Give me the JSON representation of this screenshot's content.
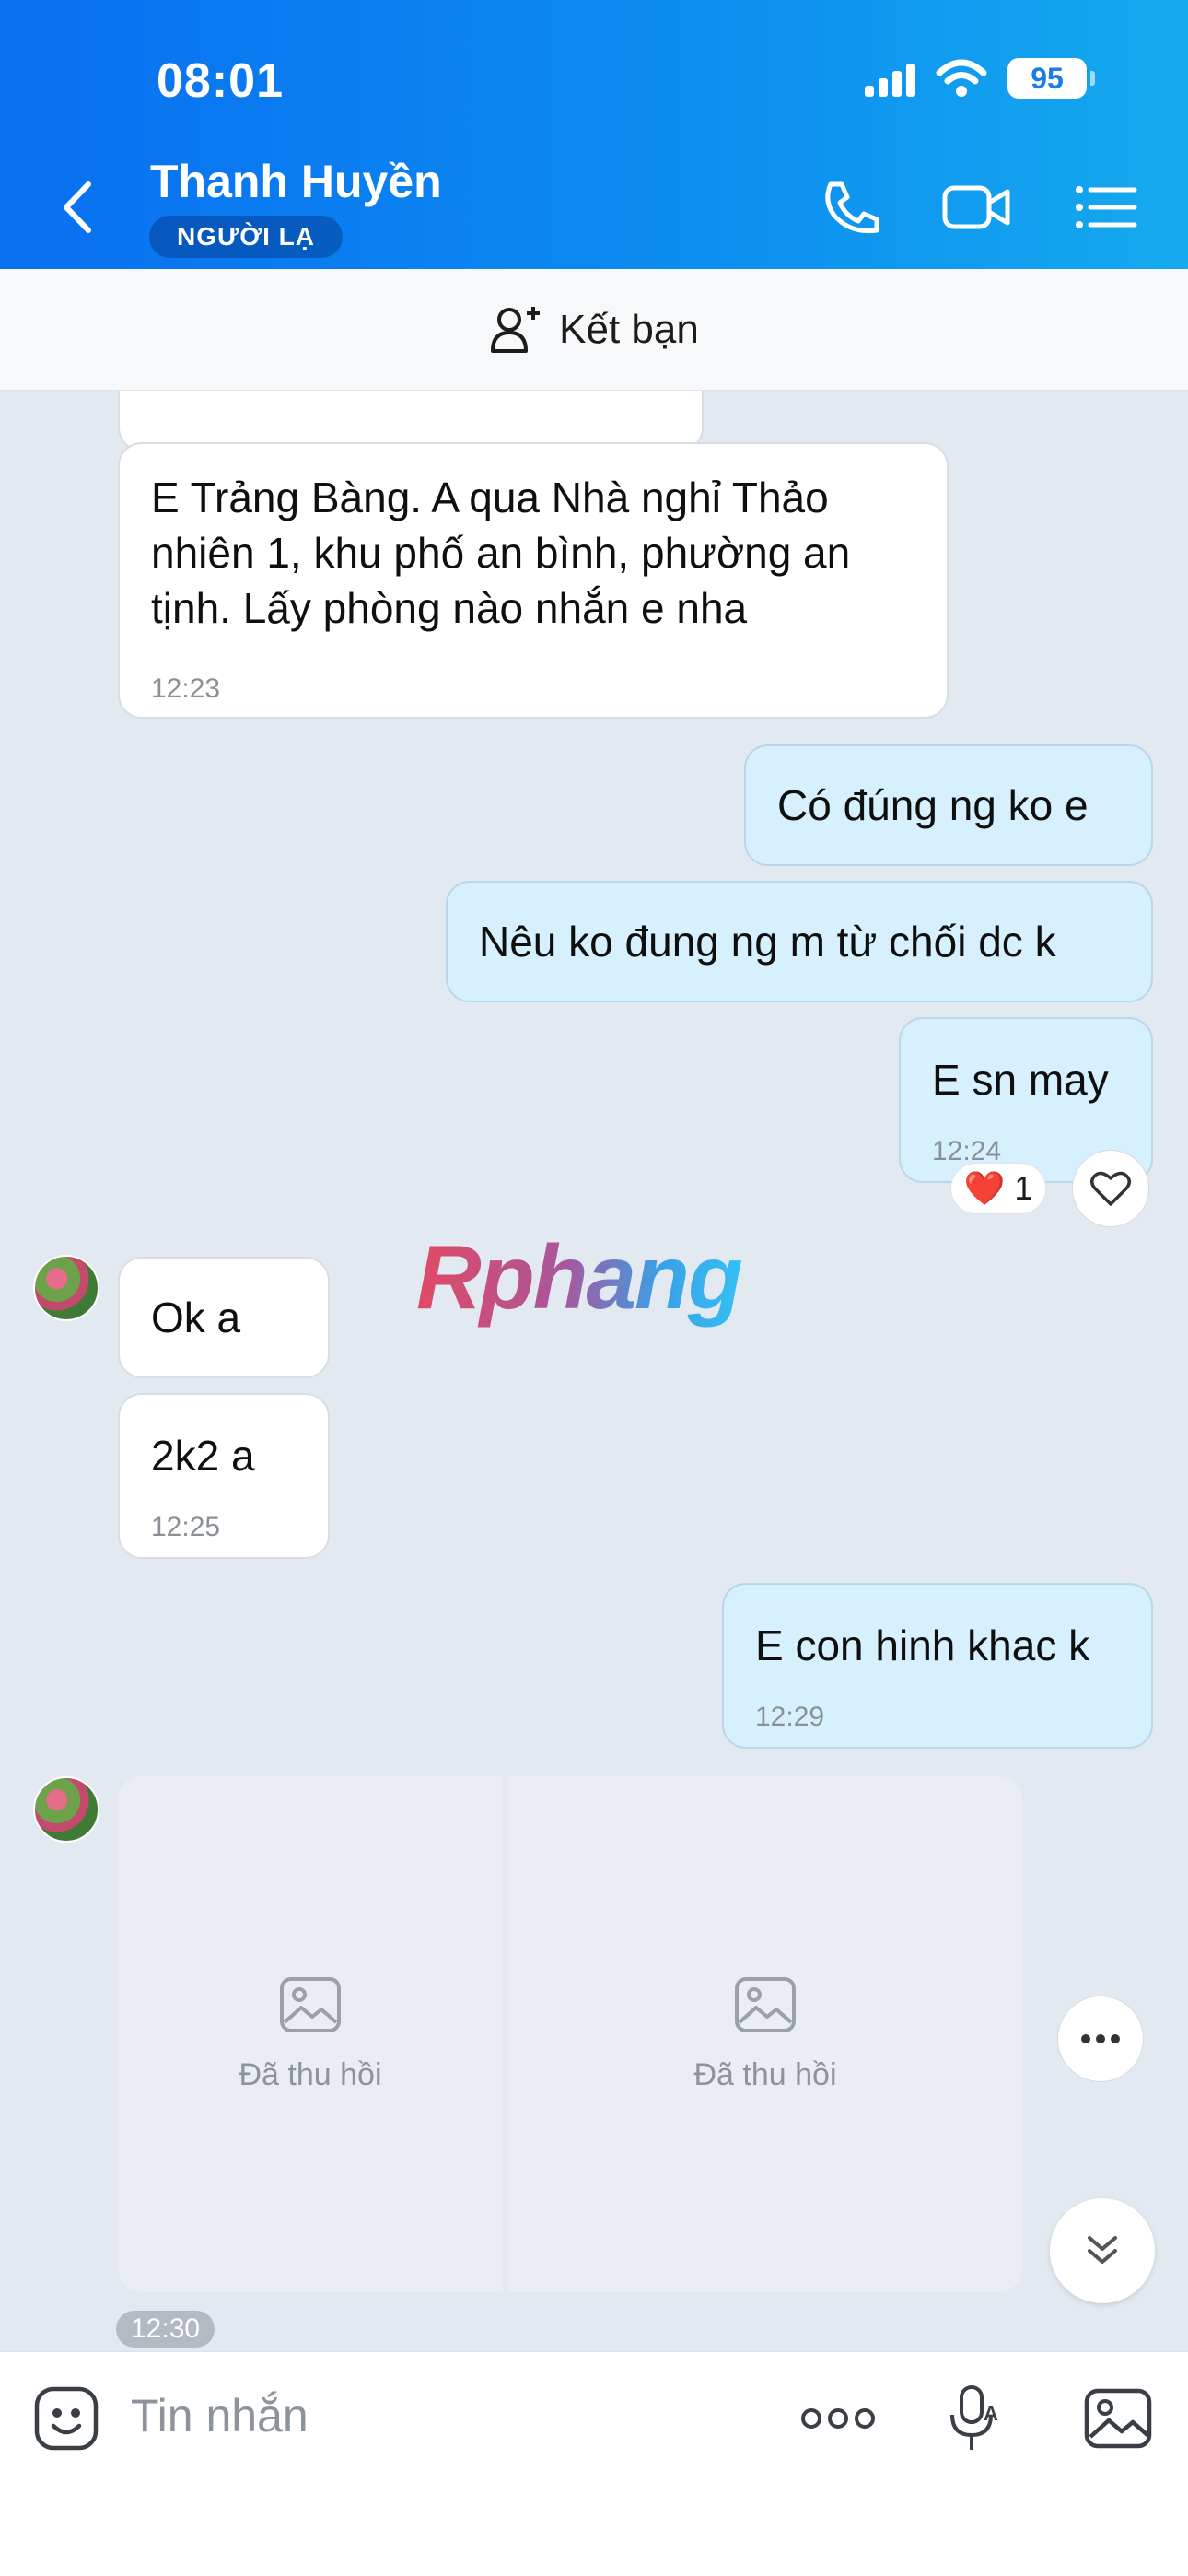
{
  "status_bar": {
    "time": "08:01",
    "battery": "95"
  },
  "header": {
    "contact_name": "Thanh Huyền",
    "badge": "NGƯỜI LẠ",
    "icons": [
      "back-icon",
      "phone-icon",
      "video-call-icon",
      "menu-list-icon"
    ]
  },
  "friend_bar": {
    "label": "Kết bạn",
    "icon": "add-user-icon"
  },
  "messages": [
    {
      "side": "in",
      "text_lines": [
        "E Trảng Bàng. A qua Nhà nghỉ Thảo",
        "nhiên 1, khu phố an bình, phường an",
        "tịnh. Lấy phòng nào nhắn e nha"
      ],
      "time": "12:23"
    },
    {
      "side": "out",
      "text": "Có đúng ng ko e"
    },
    {
      "side": "out",
      "text": "Nêu ko đung ng m từ chối dc k"
    },
    {
      "side": "out",
      "text": "E sn may",
      "time": "12:24",
      "reaction": {
        "emoji": "❤️",
        "count": "1"
      }
    },
    {
      "side": "in",
      "text": "Ok a"
    },
    {
      "side": "in",
      "text": "2k2 a",
      "time": "12:25"
    },
    {
      "side": "out",
      "text": "E con hinh khac k",
      "time": "12:29"
    },
    {
      "side": "in",
      "type": "recalled_images",
      "labels": [
        "Đã thu hồi",
        "Đã thu hồi"
      ],
      "time": "12:30"
    }
  ],
  "watermark": "Rphang",
  "input_bar": {
    "placeholder": "Tin nhắn",
    "icons": [
      "emoji-sticker-icon",
      "more-dots-icon",
      "voice-text-icon",
      "image-gallery-icon"
    ]
  },
  "colors": {
    "header_start": "#0a6ff0",
    "header_end": "#15a9ee",
    "chat_bg": "#e2e9f1",
    "outgoing_bubble": "#d7f0fd",
    "incoming_bubble": "#ffffff"
  }
}
